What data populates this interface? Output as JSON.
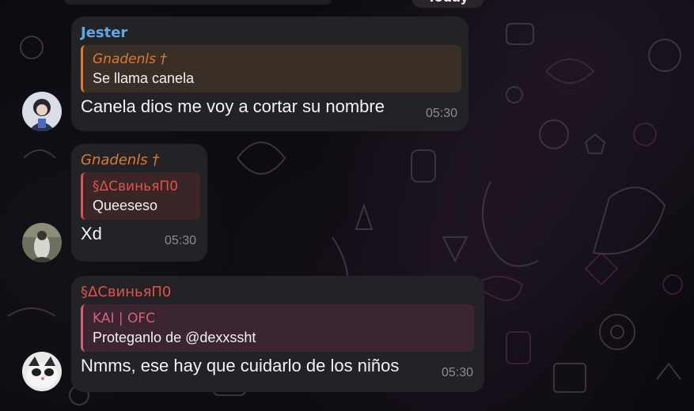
{
  "header": {
    "date_pill": "Today"
  },
  "messages": [
    {
      "sender": "Jester",
      "sender_color": "#5ea8e8",
      "reply": {
        "sender": "Gnadenls †",
        "text": "Se llama canela",
        "accent": "#e07a2f"
      },
      "text": "Canela dios me voy a cortar su nombre",
      "time": "05:30"
    },
    {
      "sender": "Gnadenls †",
      "sender_color": "#e07a2f",
      "reply": {
        "sender": "§ΔСвиньяП0",
        "text": "Queeseso",
        "accent": "#e0524d"
      },
      "text": "Xd",
      "time": "05:30"
    },
    {
      "sender": "§ΔСвиньяП0",
      "sender_color": "#e0524d",
      "reply": {
        "sender": "KAI | OFC",
        "text": "Proteganlo de @dexxssht",
        "accent": "#d9607a"
      },
      "text": "Nmms, ese hay que cuidarlo de los niños",
      "time": "05:30"
    }
  ]
}
